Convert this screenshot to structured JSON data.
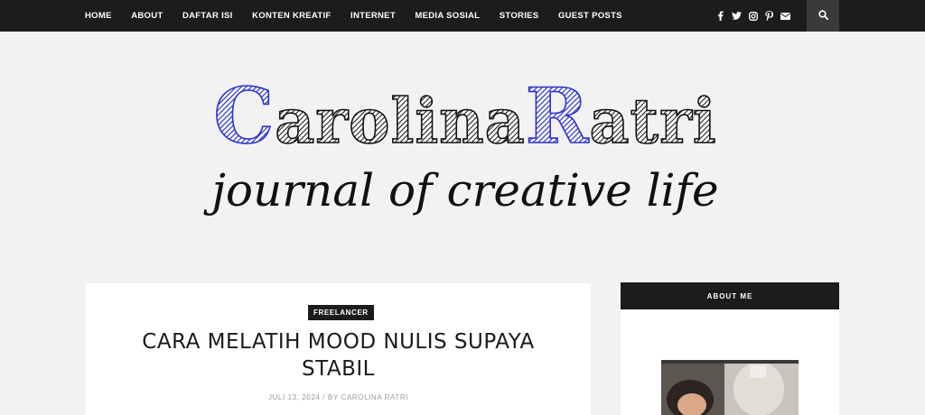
{
  "nav": {
    "items": [
      "HOME",
      "ABOUT",
      "DAFTAR ISI",
      "KONTEN KREATIF",
      "INTERNET",
      "MEDIA SOSIAL",
      "STORIES",
      "GUEST POSTS"
    ]
  },
  "social": {
    "icons": [
      "facebook-icon",
      "twitter-icon",
      "instagram-icon",
      "pinterest-icon",
      "email-icon"
    ]
  },
  "logo": {
    "name_part1_initial": "C",
    "name_part1_rest": "arolina",
    "name_part2_initial": "R",
    "name_part2_rest": "atri",
    "tagline": "journal of creative life",
    "accent_color": "#2a32c8"
  },
  "post": {
    "category": "FREELANCER",
    "title_line1": "CARA MELATIH MOOD NULIS SUPAYA",
    "title_line2": "STABIL",
    "meta": "JULI 13, 2024 / BY CAROLINA RATRI"
  },
  "sidebar": {
    "heading": "ABOUT ME"
  },
  "colors": {
    "topbar": "#1c1c1c",
    "background": "#f2f2f2",
    "search_bg": "#3a3a3a"
  }
}
